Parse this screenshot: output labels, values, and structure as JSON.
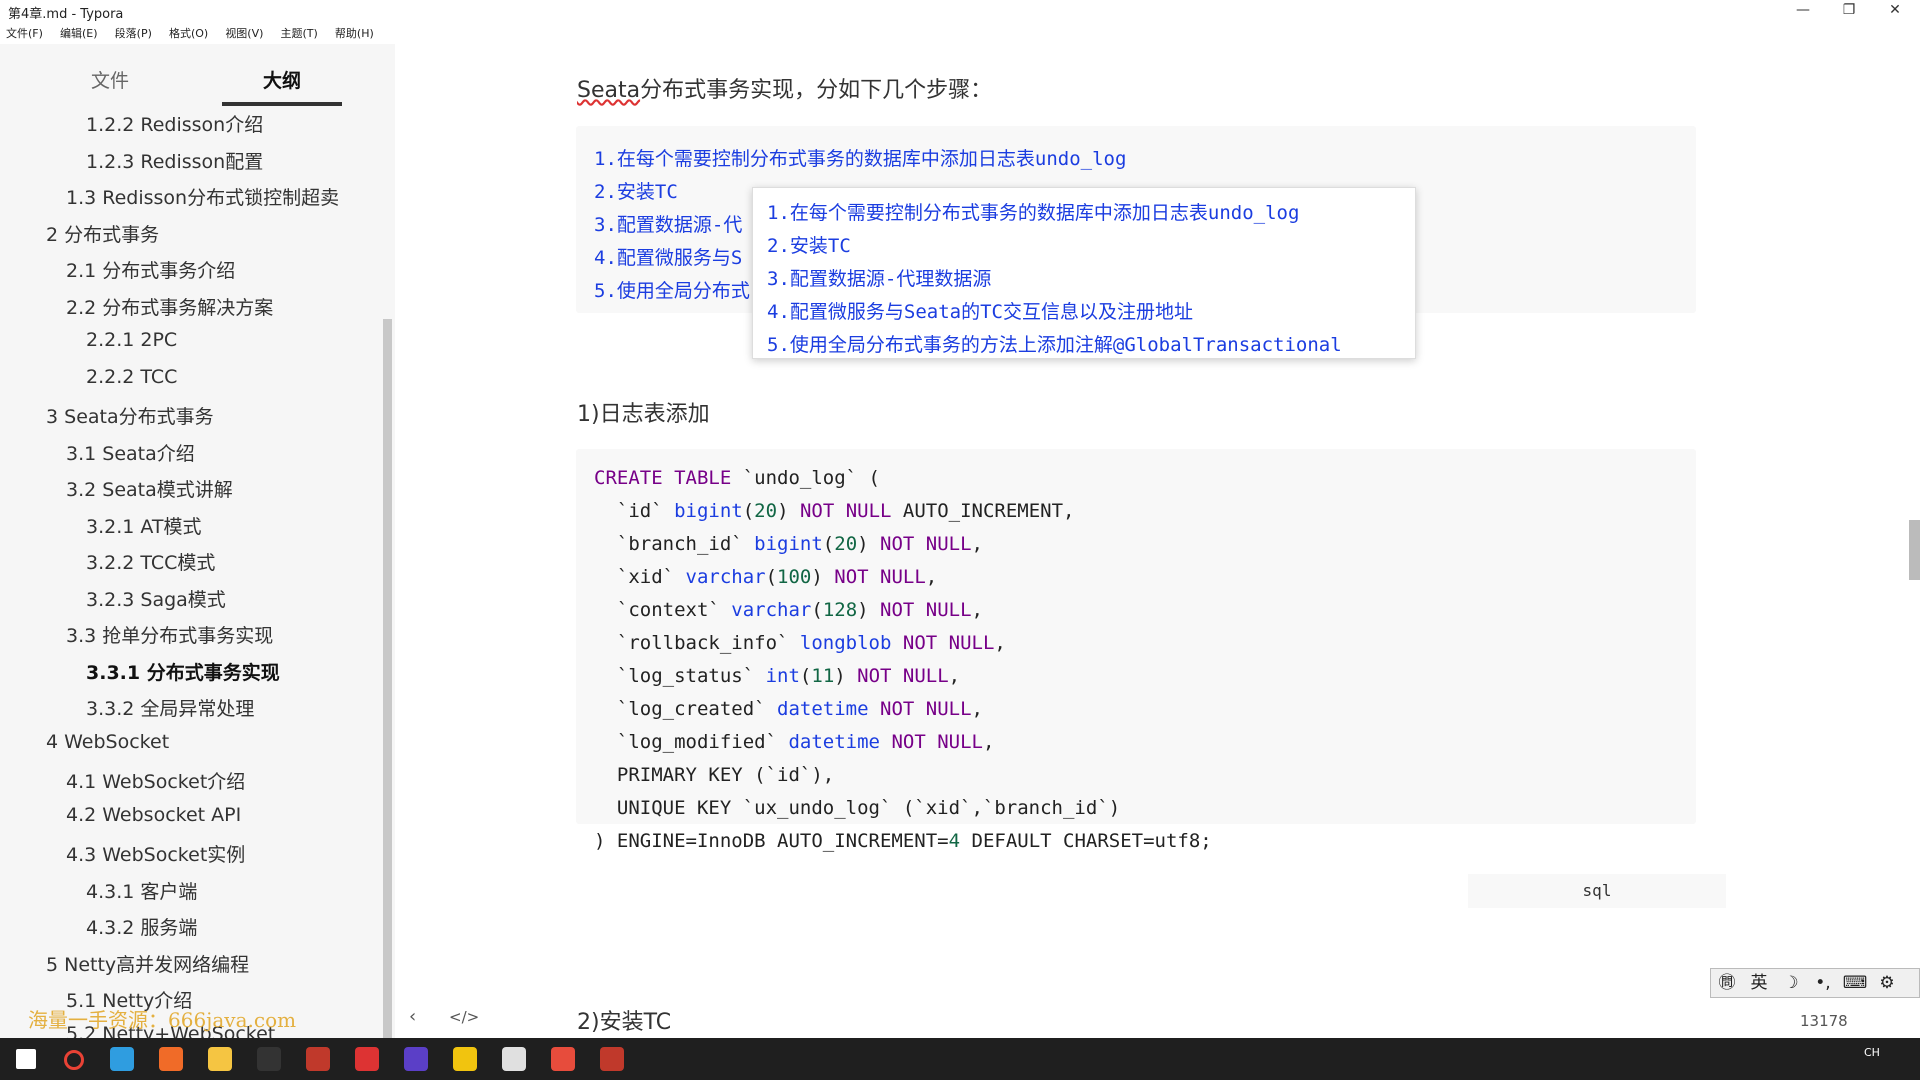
{
  "window": {
    "title": "第4章.md - Typora",
    "controls": [
      "—",
      "❐",
      "✕"
    ]
  },
  "menu": [
    "文件(F)",
    "编辑(E)",
    "段落(P)",
    "格式(O)",
    "视图(V)",
    "主题(T)",
    "帮助(H)"
  ],
  "sidebar": {
    "tabs": [
      {
        "label": "文件",
        "active": false
      },
      {
        "label": "大纲",
        "active": true
      }
    ],
    "outline": [
      {
        "label": "1.2.2 Redisson介绍",
        "active": false
      },
      {
        "label": "1.2.3 Redisson配置",
        "active": false
      },
      {
        "label": "1.3 Redisson分布式锁控制超卖",
        "active": false
      },
      {
        "label": "2 分布式事务",
        "active": false
      },
      {
        "label": "2.1 分布式事务介绍",
        "active": false
      },
      {
        "label": "2.2 分布式事务解决方案",
        "active": false
      },
      {
        "label": "2.2.1 2PC",
        "active": false
      },
      {
        "label": "2.2.2 TCC",
        "active": false
      },
      {
        "label": "3 Seata分布式事务",
        "active": false
      },
      {
        "label": "3.1 Seata介绍",
        "active": false
      },
      {
        "label": "3.2 Seata模式讲解",
        "active": false
      },
      {
        "label": "3.2.1 AT模式",
        "active": false
      },
      {
        "label": "3.2.2 TCC模式",
        "active": false
      },
      {
        "label": "3.2.3 Saga模式",
        "active": false
      },
      {
        "label": "3.3 抢单分布式事务实现",
        "active": false
      },
      {
        "label": "3.3.1 分布式事务实现",
        "active": true
      },
      {
        "label": "3.3.2 全局异常处理",
        "active": false
      },
      {
        "label": "4 WebSocket",
        "active": false
      },
      {
        "label": "4.1 WebSocket介绍",
        "active": false
      },
      {
        "label": "4.2 Websocket API",
        "active": false
      },
      {
        "label": "4.3 WebSocket实例",
        "active": false
      },
      {
        "label": "4.3.1 客户端",
        "active": false
      },
      {
        "label": "4.3.2 服务端",
        "active": false
      },
      {
        "label": "5 Netty高并发网络编程",
        "active": false
      },
      {
        "label": "5.1 Netty介绍",
        "active": false
      },
      {
        "label": "5.2 Netty+WebSocket",
        "active": false
      }
    ],
    "watermark": "海量一手资源：666java.com"
  },
  "document": {
    "heading_prefix": "Seata",
    "heading_rest": "分布式事务实现，分如下几个步骤：",
    "steps_partial": [
      "1.在每个需要控制分布式事务的数据库中添加日志表undo_log",
      "2.安装TC",
      "3.配置数据源-代",
      "4.配置微服务与S",
      "5.使用全局分布式"
    ],
    "popup_steps": [
      "1.在每个需要控制分布式事务的数据库中添加日志表undo_log",
      "2.安装TC",
      "3.配置数据源-代理数据源",
      "4.配置微服务与Seata的TC交互信息以及注册地址",
      "5.使用全局分布式事务的方法上添加注解@GlobalTransactional"
    ],
    "section1": "1)日志表添加",
    "sql": [
      [
        {
          "t": "CREATE TABLE",
          "c": "kw"
        },
        {
          "t": " `undo_log` (",
          "c": "plain"
        }
      ],
      [
        {
          "t": "  `id` ",
          "c": "plain"
        },
        {
          "t": "bigint",
          "c": "ty"
        },
        {
          "t": "(",
          "c": "plain"
        },
        {
          "t": "20",
          "c": "num"
        },
        {
          "t": ") ",
          "c": "plain"
        },
        {
          "t": "NOT NULL",
          "c": "kw"
        },
        {
          "t": " AUTO_INCREMENT,",
          "c": "plain"
        }
      ],
      [
        {
          "t": "  `branch_id` ",
          "c": "plain"
        },
        {
          "t": "bigint",
          "c": "ty"
        },
        {
          "t": "(",
          "c": "plain"
        },
        {
          "t": "20",
          "c": "num"
        },
        {
          "t": ") ",
          "c": "plain"
        },
        {
          "t": "NOT NULL",
          "c": "kw"
        },
        {
          "t": ",",
          "c": "plain"
        }
      ],
      [
        {
          "t": "  `xid` ",
          "c": "plain"
        },
        {
          "t": "varchar",
          "c": "ty"
        },
        {
          "t": "(",
          "c": "plain"
        },
        {
          "t": "100",
          "c": "num"
        },
        {
          "t": ") ",
          "c": "plain"
        },
        {
          "t": "NOT NULL",
          "c": "kw"
        },
        {
          "t": ",",
          "c": "plain"
        }
      ],
      [
        {
          "t": "  `context` ",
          "c": "plain"
        },
        {
          "t": "varchar",
          "c": "ty"
        },
        {
          "t": "(",
          "c": "plain"
        },
        {
          "t": "128",
          "c": "num"
        },
        {
          "t": ") ",
          "c": "plain"
        },
        {
          "t": "NOT NULL",
          "c": "kw"
        },
        {
          "t": ",",
          "c": "plain"
        }
      ],
      [
        {
          "t": "  `rollback_info` ",
          "c": "plain"
        },
        {
          "t": "longblob",
          "c": "ty"
        },
        {
          "t": " ",
          "c": "plain"
        },
        {
          "t": "NOT NULL",
          "c": "kw"
        },
        {
          "t": ",",
          "c": "plain"
        }
      ],
      [
        {
          "t": "  `log_status` ",
          "c": "plain"
        },
        {
          "t": "int",
          "c": "ty"
        },
        {
          "t": "(",
          "c": "plain"
        },
        {
          "t": "11",
          "c": "num"
        },
        {
          "t": ") ",
          "c": "plain"
        },
        {
          "t": "NOT NULL",
          "c": "kw"
        },
        {
          "t": ",",
          "c": "plain"
        }
      ],
      [
        {
          "t": "  `log_created` ",
          "c": "plain"
        },
        {
          "t": "datetime",
          "c": "ty"
        },
        {
          "t": " ",
          "c": "plain"
        },
        {
          "t": "NOT NULL",
          "c": "kw"
        },
        {
          "t": ",",
          "c": "plain"
        }
      ],
      [
        {
          "t": "  `log_modified` ",
          "c": "plain"
        },
        {
          "t": "datetime",
          "c": "ty"
        },
        {
          "t": " ",
          "c": "plain"
        },
        {
          "t": "NOT NULL",
          "c": "kw"
        },
        {
          "t": ",",
          "c": "plain"
        }
      ],
      [
        {
          "t": "  PRIMARY KEY (`id`),",
          "c": "plain"
        }
      ],
      [
        {
          "t": "  UNIQUE KEY `ux_undo_log` (`xid`,`branch_id`)",
          "c": "plain"
        }
      ],
      [
        {
          "t": ") ENGINE=InnoDB AUTO_INCREMENT=",
          "c": "plain"
        },
        {
          "t": "4",
          "c": "num"
        },
        {
          "t": " DEFAULT CHARSET=utf8;",
          "c": "plain"
        }
      ]
    ],
    "code_lang": "sql",
    "section2": "2)安装TC"
  },
  "statusbar": {
    "nav_prev": "‹",
    "nav_code": "</>",
    "word_count": "13178"
  },
  "ime": [
    "㉄",
    "英",
    "☽",
    "•,",
    "⌨",
    "⚙"
  ],
  "taskbar": {
    "tray_text": "CH",
    "icon_colors": [
      "#ffffff",
      "#e94235",
      "#2f9de0",
      "#f06b28",
      "#f5c542",
      "#333333",
      "#c0392b",
      "#d33",
      "#5b3fc7",
      "#f1c40f",
      "#e0e0e0",
      "#e74c3c",
      "#c0392b"
    ]
  }
}
